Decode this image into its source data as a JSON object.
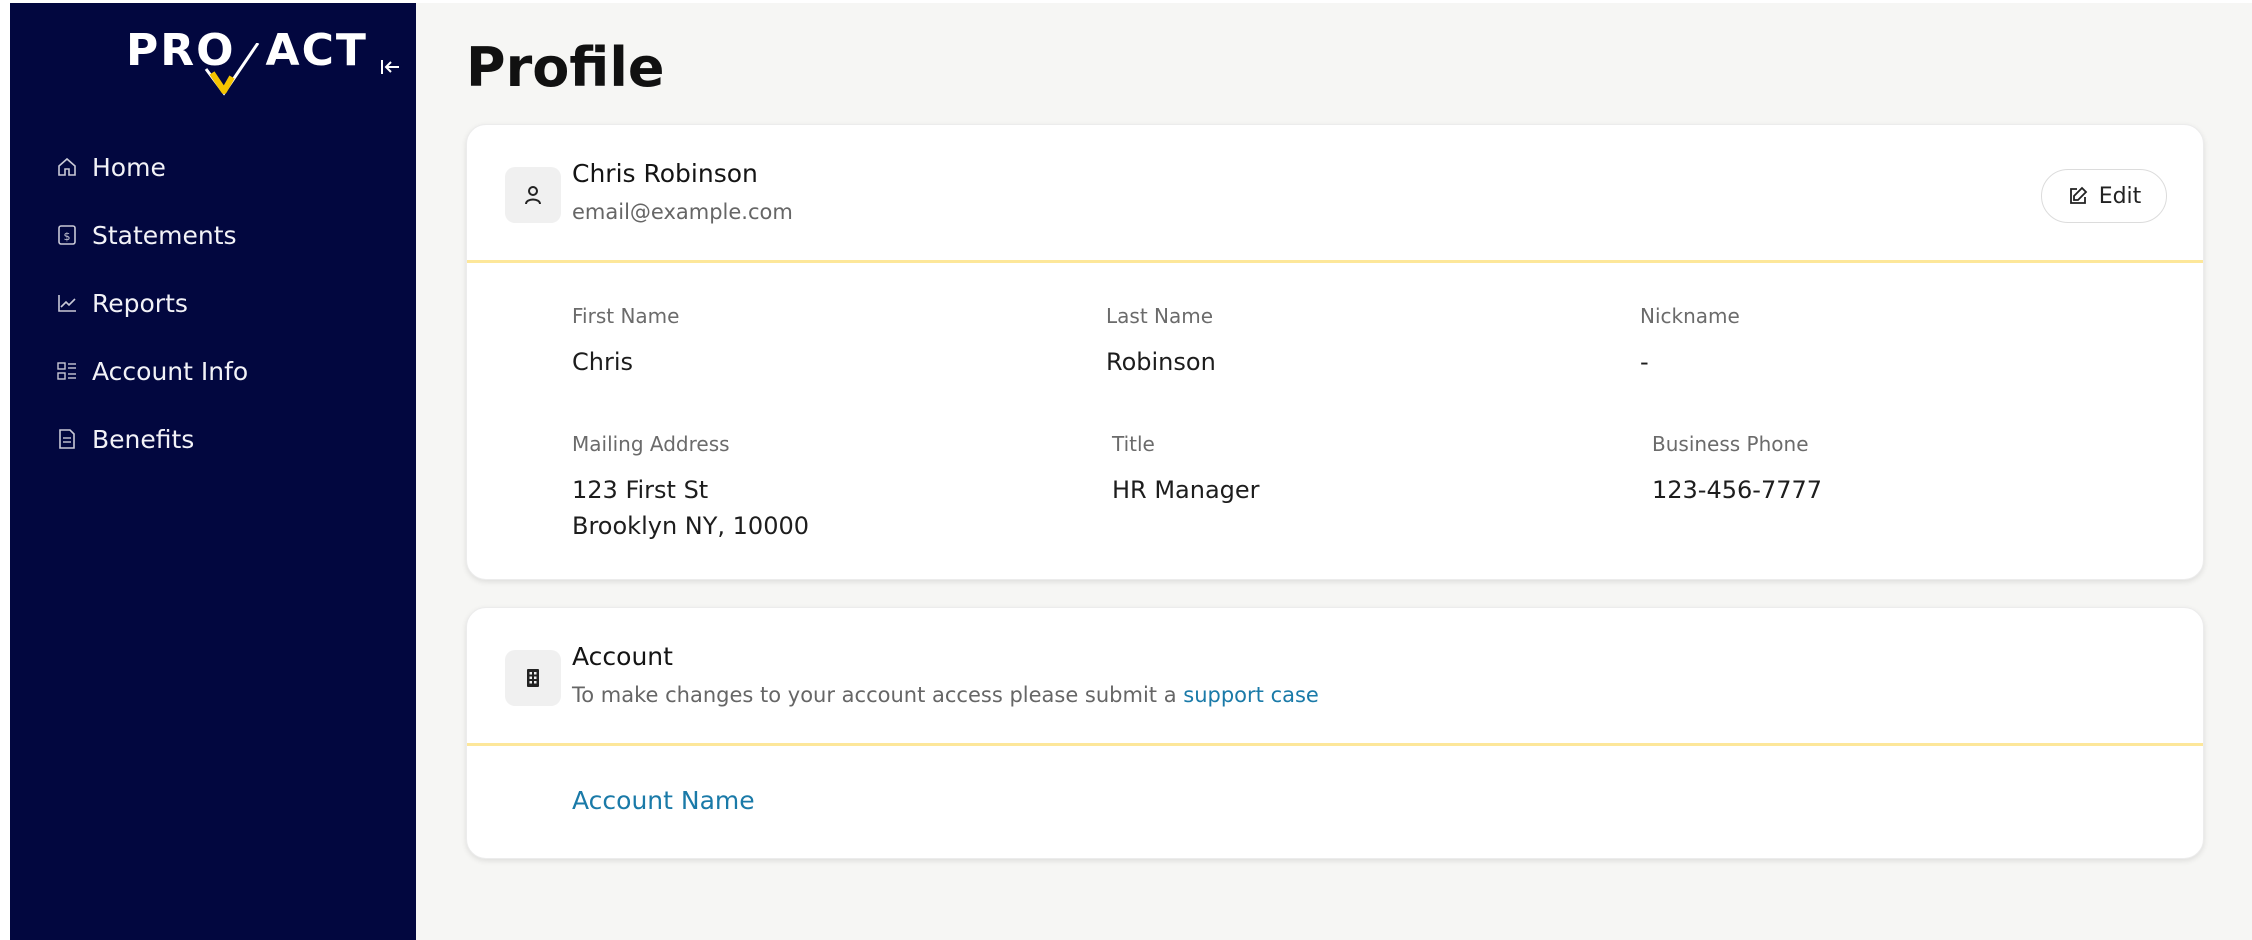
{
  "brand": {
    "logo_left": "PRO",
    "logo_right": "ACT",
    "check_color": "#f5c400"
  },
  "colors": {
    "sidebar": "#02073f",
    "accent_line": "#fde79a",
    "link": "#1a7aa8"
  },
  "sidebar": {
    "collapse_icon": "collapse-left-icon",
    "items": [
      {
        "label": "Home",
        "icon": "home-icon"
      },
      {
        "label": "Statements",
        "icon": "statement-icon"
      },
      {
        "label": "Reports",
        "icon": "chart-icon"
      },
      {
        "label": "Account Info",
        "icon": "account-info-icon"
      },
      {
        "label": "Benefits",
        "icon": "document-icon"
      }
    ]
  },
  "page": {
    "title": "Profile"
  },
  "profile": {
    "name": "Chris Robinson",
    "email": "email@example.com",
    "edit_label": "Edit",
    "fields": {
      "first_name": {
        "label": "First Name",
        "value": "Chris"
      },
      "last_name": {
        "label": "Last Name",
        "value": "Robinson"
      },
      "nickname": {
        "label": "Nickname",
        "value": "-"
      },
      "mailing_address": {
        "label": "Mailing Address",
        "line1": "123 First St",
        "line2": "Brooklyn NY, 10000"
      },
      "title": {
        "label": "Title",
        "value": "HR Manager"
      },
      "business_phone": {
        "label": "Business Phone",
        "value": "123-456-7777"
      }
    }
  },
  "account": {
    "title": "Account",
    "description": "To make changes to your account access please submit a ",
    "link_text": "support case",
    "account_name_label": "Account Name"
  }
}
